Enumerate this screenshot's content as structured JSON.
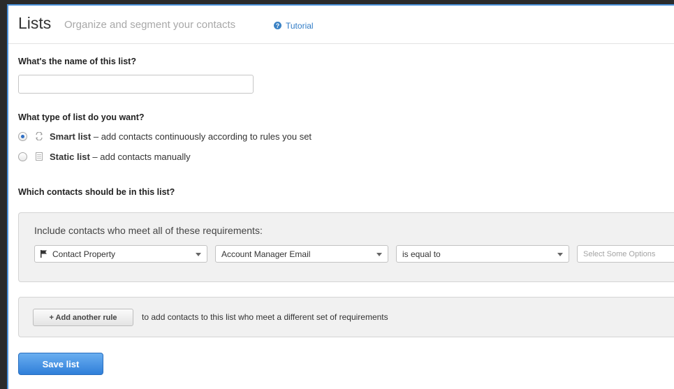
{
  "header": {
    "title": "Lists",
    "subtitle": "Organize and segment your contacts",
    "help_icon": "question-circle-icon",
    "tutorial_link": "Tutorial"
  },
  "name_section": {
    "question": "What's the name of this list?",
    "value": "",
    "placeholder": ""
  },
  "type_section": {
    "question": "What type of list do you want?",
    "options": [
      {
        "label": "Smart list",
        "desc": " – add contacts continuously according to rules you set",
        "icon": "refresh-icon",
        "selected": true
      },
      {
        "label": "Static list",
        "desc": " – add contacts manually",
        "icon": "document-icon",
        "selected": false
      }
    ]
  },
  "contacts_section": {
    "question": "Which contacts should be in this list?",
    "requirements_intro": "Include contacts who meet all of these requirements:",
    "filters": {
      "property_type": "Contact Property",
      "property": "Account Manager Email",
      "operator": "is equal to",
      "value_placeholder": "Select Some Options"
    }
  },
  "add_rule": {
    "button_label": "+ Add another rule",
    "description": "to add contacts to this list who meet a different set of requirements"
  },
  "save_button": "Save list",
  "colors": {
    "accent": "#2f7fd9",
    "link": "#2f7bc6",
    "border_highlight": "#4a90d9"
  }
}
